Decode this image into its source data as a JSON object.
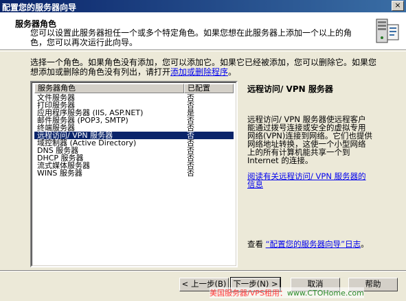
{
  "window": {
    "title": "配置您的服务器向导",
    "close_glyph": "×"
  },
  "header": {
    "title": "服务器角色",
    "description_lines": [
      "您可以设置此服务器担任一个或多个特定角色。如果您想在此服务器上添加一个以上的角",
      "色，您可以再次运行此向导。"
    ],
    "icon": "server-wizard-icon"
  },
  "intro": {
    "line1": "选择一个角色。如果角色没有添加，您可以添加它。如果它已经被添加，您可以删除它。如果您",
    "line2_prefix": "想添加或删除的角色没有列出，请打开",
    "line2_link": "添加或删除程序",
    "line2_suffix": "。"
  },
  "roles_list": {
    "columns": [
      "服务器角色",
      "已配置"
    ],
    "rows": [
      {
        "role": "文件服务器",
        "configured": "否"
      },
      {
        "role": "打印服务器",
        "configured": "否"
      },
      {
        "role": "应用程序服务器 (IIS, ASP.NET)",
        "configured": "是"
      },
      {
        "role": "邮件服务器 (POP3, SMTP)",
        "configured": "否"
      },
      {
        "role": "终端服务器",
        "configured": "否"
      },
      {
        "role": "远程访问/ VPN 服务器",
        "configured": "否"
      },
      {
        "role": "域控制器 (Active Directory)",
        "configured": "否"
      },
      {
        "role": "DNS 服务器",
        "configured": "否"
      },
      {
        "role": "DHCP 服务器",
        "configured": "否"
      },
      {
        "role": "流式媒体服务器",
        "configured": "否"
      },
      {
        "role": "WINS 服务器",
        "configured": "否"
      }
    ],
    "selected_index": 5
  },
  "detail": {
    "title": "远程访问/ VPN 服务器",
    "description_lines": [
      "远程访问/ VPN 服务器使远程客户",
      "能通过拨号连接或安全的虚拟专用",
      "网络(VPN)连接到网络。它们也提供",
      "网络地址转换，这使一个小型网络",
      "上的所有计算机能共享一个到",
      "Internet 的连接。"
    ],
    "read_more_lines": [
      "阅读有关远程访问/ VPN 服务器的",
      "信息"
    ],
    "log_prefix": "查看 ",
    "log_link": "“配置您的服务器向导”日志",
    "log_suffix": "。"
  },
  "buttons": {
    "back": "< 上一步(B)",
    "next": "下一步(N) >",
    "cancel": "取消",
    "help": "帮助"
  },
  "watermark": {
    "text": "美国服务器/VPS租用：",
    "site": "www.CTOHome.com"
  }
}
